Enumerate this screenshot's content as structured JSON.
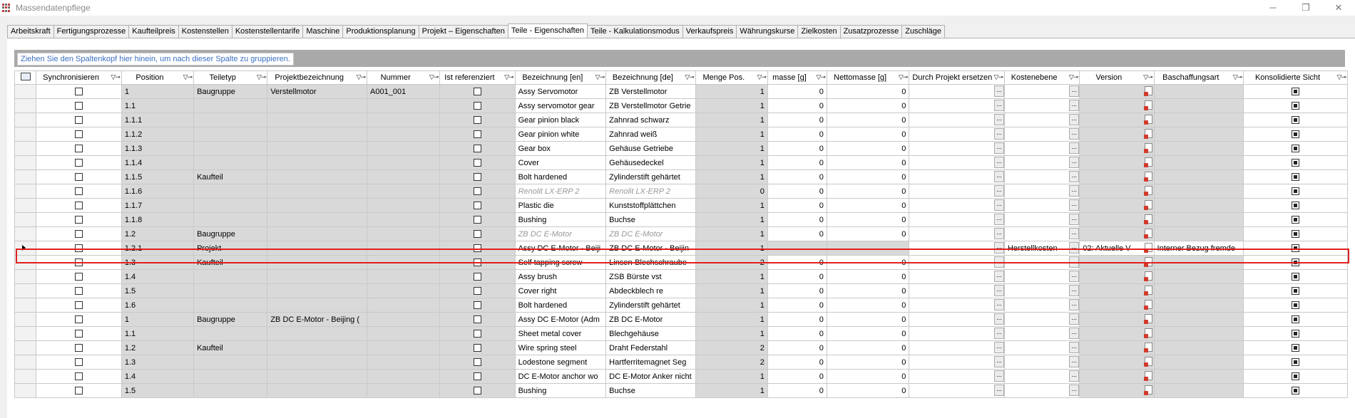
{
  "window": {
    "title": "Massendatenpflege"
  },
  "tabs": [
    "Arbeitskraft",
    "Fertigungsprozesse",
    "Kaufteilpreis",
    "Kostenstellen",
    "Kostenstellentarife",
    "Maschine",
    "Produktionsplanung",
    "Projekt – Eigenschaften",
    "Teile - Eigenschaften",
    "Teile - Kalkulationsmodus",
    "Verkaufspreis",
    "Währungskurse",
    "Zielkosten",
    "Zusatzprozesse",
    "Zuschläge"
  ],
  "active_tab": "Teile - Eigenschaften",
  "group_hint": "Ziehen Sie den Spaltenkopf hier hinein, um nach dieser Spalte zu gruppieren.",
  "columns": [
    "Synchronisieren",
    "Position",
    "Teiletyp",
    "Projektbezeichnung",
    "Nummer",
    "Ist referenziert",
    "Bezeichnung [en]",
    "Bezeichnung [de]",
    "Menge Pos.",
    "masse [g]",
    "Nettomasse [g]",
    "Durch Projekt ersetzen",
    "Kostenebene",
    "Version",
    "Baschaffungsart",
    "Konsolidierte Sicht"
  ],
  "rows": [
    {
      "pos": "1",
      "typ": "Baugruppe",
      "proj": "Verstellmotor",
      "num": "A001_001",
      "en": "Assy Servomotor",
      "de": "ZB Verstellmotor",
      "menge": "1",
      "masse": "0",
      "netto": "0",
      "it": false
    },
    {
      "pos": "1.1",
      "typ": "",
      "proj": "",
      "num": "",
      "en": "Assy servomotor gear",
      "de": "ZB Verstellmotor Getrie",
      "menge": "1",
      "masse": "0",
      "netto": "0",
      "it": false
    },
    {
      "pos": "1.1.1",
      "typ": "",
      "proj": "",
      "num": "",
      "en": "Gear pinion black",
      "de": "Zahnrad schwarz",
      "menge": "1",
      "masse": "0",
      "netto": "0",
      "it": false
    },
    {
      "pos": "1.1.2",
      "typ": "",
      "proj": "",
      "num": "",
      "en": "Gear pinion white",
      "de": "Zahnrad weiß",
      "menge": "1",
      "masse": "0",
      "netto": "0",
      "it": false
    },
    {
      "pos": "1.1.3",
      "typ": "",
      "proj": "",
      "num": "",
      "en": "Gear box",
      "de": "Gehäuse Getriebe",
      "menge": "1",
      "masse": "0",
      "netto": "0",
      "it": false
    },
    {
      "pos": "1.1.4",
      "typ": "",
      "proj": "",
      "num": "",
      "en": "Cover",
      "de": "Gehäusedeckel",
      "menge": "1",
      "masse": "0",
      "netto": "0",
      "it": false
    },
    {
      "pos": "1.1.5",
      "typ": "Kaufteil",
      "proj": "",
      "num": "",
      "en": "Bolt hardened",
      "de": "Zylinderstift gehärtet",
      "menge": "1",
      "masse": "0",
      "netto": "0",
      "it": false
    },
    {
      "pos": "1.1.6",
      "typ": "",
      "proj": "",
      "num": "",
      "en": "Renolit LX-ERP 2",
      "de": "Renolit LX-ERP 2",
      "menge": "0",
      "masse": "0",
      "netto": "0",
      "it": true
    },
    {
      "pos": "1.1.7",
      "typ": "",
      "proj": "",
      "num": "",
      "en": "Plastic die",
      "de": "Kunststoffplättchen",
      "menge": "1",
      "masse": "0",
      "netto": "0",
      "it": false
    },
    {
      "pos": "1.1.8",
      "typ": "",
      "proj": "",
      "num": "",
      "en": "Bushing",
      "de": "Buchse",
      "menge": "1",
      "masse": "0",
      "netto": "0",
      "it": false
    },
    {
      "pos": "1.2",
      "typ": "Baugruppe",
      "proj": "",
      "num": "",
      "en": "ZB DC E-Motor",
      "de": "ZB DC E-Motor",
      "menge": "1",
      "masse": "0",
      "netto": "0",
      "it": true
    },
    {
      "pos": "1.2.1",
      "typ": "Projekt",
      "proj": "",
      "num": "",
      "en": "Assy DC E-Motor - Beiji",
      "de": "ZB DC E-Motor - Beijin",
      "menge": "1",
      "masse": "",
      "netto": "",
      "it": false,
      "kosten": "Herstellkosten",
      "version": "02: Aktuelle V",
      "beschaffung": "Interner Bezug fremde",
      "selected": true
    },
    {
      "pos": "1.3",
      "typ": "Kaufteil",
      "proj": "",
      "num": "",
      "en": "Self tapping screw",
      "de": "Linsen-Blechschraube",
      "menge": "2",
      "masse": "0",
      "netto": "0",
      "it": false
    },
    {
      "pos": "1.4",
      "typ": "",
      "proj": "",
      "num": "",
      "en": "Assy brush",
      "de": "ZSB Bürste vst",
      "menge": "1",
      "masse": "0",
      "netto": "0",
      "it": false
    },
    {
      "pos": "1.5",
      "typ": "",
      "proj": "",
      "num": "",
      "en": "Cover right",
      "de": "Abdeckblech re",
      "menge": "1",
      "masse": "0",
      "netto": "0",
      "it": false
    },
    {
      "pos": "1.6",
      "typ": "",
      "proj": "",
      "num": "",
      "en": "Bolt hardened",
      "de": "Zylinderstift gehärtet",
      "menge": "1",
      "masse": "0",
      "netto": "0",
      "it": false
    },
    {
      "pos": "1",
      "typ": "Baugruppe",
      "proj": "ZB DC E-Motor - Beijing (",
      "num": "",
      "en": "Assy DC E-Motor (Adm",
      "de": "ZB DC E-Motor",
      "menge": "1",
      "masse": "0",
      "netto": "0",
      "it": false
    },
    {
      "pos": "1.1",
      "typ": "",
      "proj": "",
      "num": "",
      "en": "Sheet metal cover",
      "de": "Blechgehäuse",
      "menge": "1",
      "masse": "0",
      "netto": "0",
      "it": false
    },
    {
      "pos": "1.2",
      "typ": "Kaufteil",
      "proj": "",
      "num": "",
      "en": "Wire spring steel",
      "de": "Draht Federstahl",
      "menge": "2",
      "masse": "0",
      "netto": "0",
      "it": false
    },
    {
      "pos": "1.3",
      "typ": "",
      "proj": "",
      "num": "",
      "en": "Lodestone segment",
      "de": "Hartferritemagnet Seg",
      "menge": "2",
      "masse": "0",
      "netto": "0",
      "it": false
    },
    {
      "pos": "1.4",
      "typ": "",
      "proj": "",
      "num": "",
      "en": "DC E-Motor anchor wo",
      "de": "DC E-Motor Anker nicht",
      "menge": "1",
      "masse": "0",
      "netto": "0",
      "it": false
    },
    {
      "pos": "1.5",
      "typ": "",
      "proj": "",
      "num": "",
      "en": "Bushing",
      "de": "Buchse",
      "menge": "1",
      "masse": "0",
      "netto": "0",
      "it": false
    }
  ],
  "ellipsis": "..."
}
